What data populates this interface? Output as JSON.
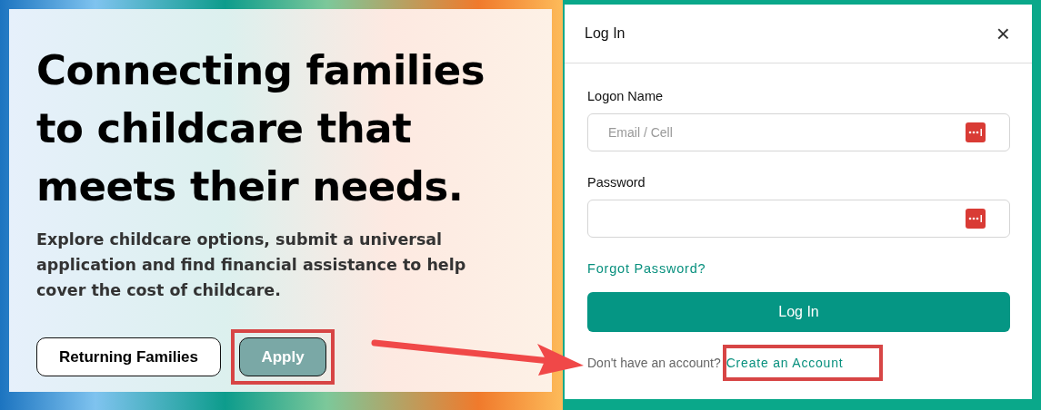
{
  "hero": {
    "heading": "Connecting families to childcare that meets their needs.",
    "text": "Explore childcare options, submit a universal application and find financial assistance to help cover the cost of childcare.",
    "buttons": [
      {
        "label": "Returning Families",
        "kind": "outline",
        "highlighted": false
      },
      {
        "label": "Apply",
        "kind": "filled",
        "highlighted": true
      }
    ]
  },
  "dialog": {
    "title": "Log In",
    "close": "×",
    "fields": [
      {
        "label": "Logon Name",
        "placeholder": "Email / Cell"
      },
      {
        "label": "Password"
      }
    ],
    "forgot_link": "Forgot Password?",
    "submit": "Log In",
    "signup_prompt": "Don't have an account?",
    "signup_link": "Create an Account",
    "signup_highlighted": true
  }
}
